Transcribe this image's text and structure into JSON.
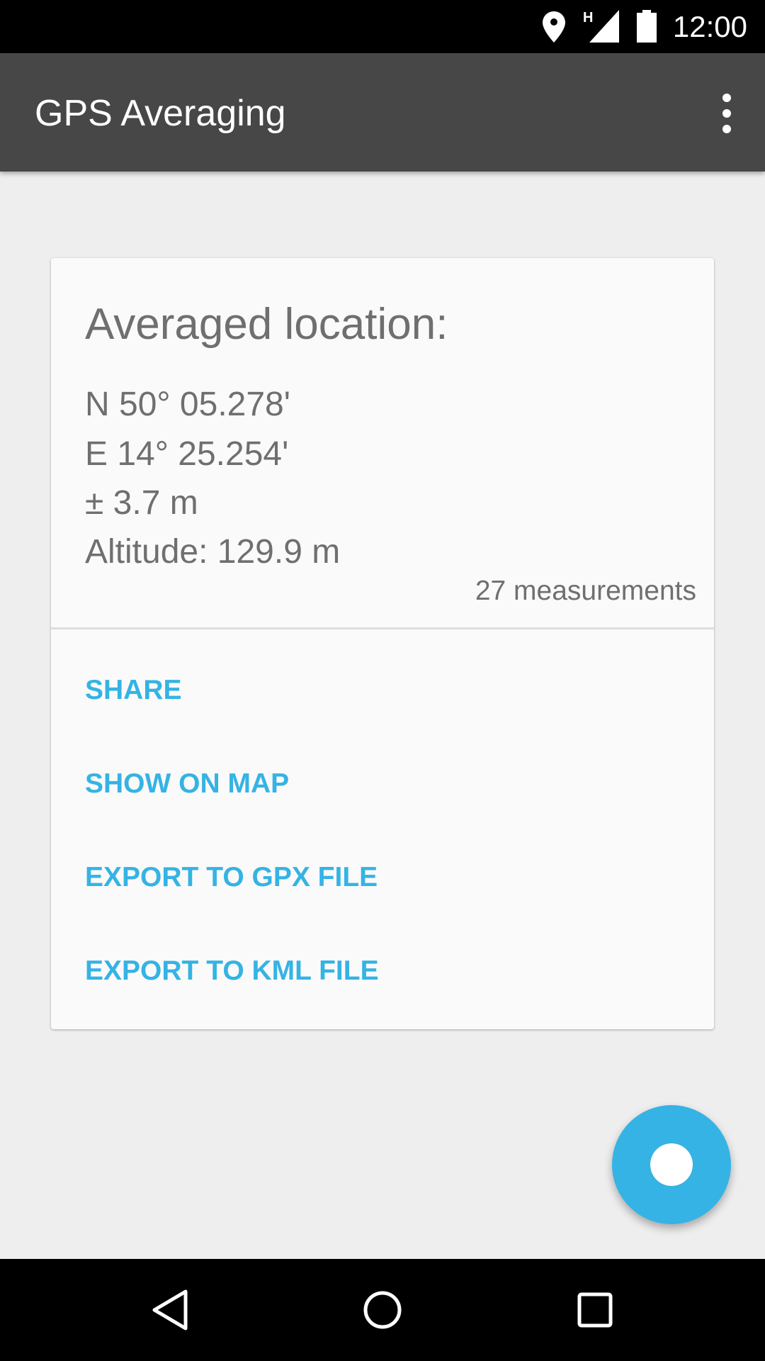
{
  "status_bar": {
    "time": "12:00",
    "network_type": "H",
    "icons": [
      "location-icon",
      "signal-icon",
      "battery-icon"
    ]
  },
  "app_bar": {
    "title": "GPS Averaging",
    "menu_icon": "more-vert-icon"
  },
  "card": {
    "heading": "Averaged location:",
    "latitude": "N 50° 05.278'",
    "longitude": "E 14° 25.254'",
    "accuracy": "± 3.7 m",
    "altitude": "Altitude: 129.9 m",
    "measurements": "27 measurements",
    "actions": [
      "SHARE",
      "SHOW ON MAP",
      "EXPORT TO GPX FILE",
      "EXPORT TO KML FILE"
    ]
  },
  "fab": {
    "icon": "record-icon"
  },
  "nav_bar": {
    "icons": [
      "back-icon",
      "home-icon",
      "recents-icon"
    ]
  },
  "colors": {
    "accent": "#35b3e4",
    "app_bar": "#474747",
    "text": "#6f6f6f"
  }
}
